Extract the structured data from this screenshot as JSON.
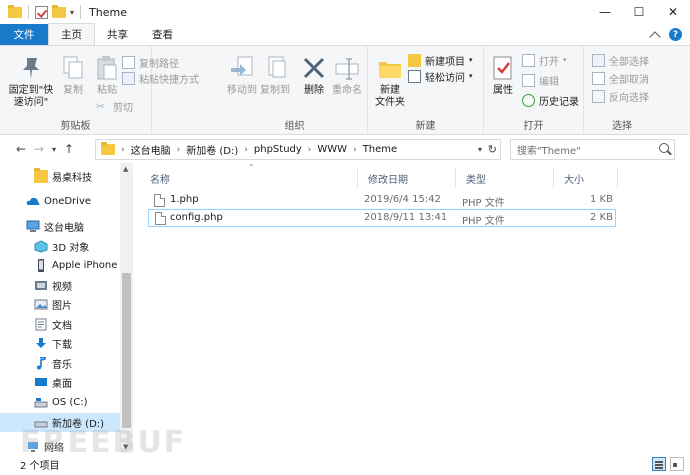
{
  "window": {
    "title": "Theme",
    "controls": {
      "minimize": "—",
      "maximize": "☐",
      "close": "✕"
    }
  },
  "tabs": [
    {
      "label": "文件"
    },
    {
      "label": "主页"
    },
    {
      "label": "共享"
    },
    {
      "label": "查看"
    }
  ],
  "ribbon": {
    "clipboard": {
      "label": "剪贴板",
      "pin": "固定到\"快\n速访问\"",
      "copy": "复制",
      "paste": "粘贴",
      "copy_path": "复制路径",
      "paste_shortcut": "粘贴快捷方式",
      "cut": "剪切"
    },
    "organize": {
      "label": "组织",
      "move_to": "移动到",
      "copy_to": "复制到",
      "delete": "删除",
      "rename": "重命名"
    },
    "new": {
      "label": "新建",
      "new_folder": "新建\n文件夹",
      "new_item": "新建项目",
      "easy_access": "轻松访问"
    },
    "open": {
      "label": "打开",
      "properties": "属性",
      "open": "打开",
      "edit": "编辑",
      "history": "历史记录"
    },
    "select": {
      "label": "选择",
      "select_all": "全部选择",
      "select_none": "全部取消",
      "invert": "反向选择"
    }
  },
  "address": {
    "crumbs": [
      "这台电脑",
      "新加卷 (D:)",
      "phpStudy",
      "WWW",
      "Theme"
    ],
    "search_placeholder": "搜索\"Theme\""
  },
  "nav": {
    "items": [
      {
        "label": "易桌科技"
      },
      {
        "label": "OneDrive"
      },
      {
        "label": "这台电脑"
      },
      {
        "label": "3D 对象"
      },
      {
        "label": "Apple iPhone"
      },
      {
        "label": "视频"
      },
      {
        "label": "图片"
      },
      {
        "label": "文档"
      },
      {
        "label": "下载"
      },
      {
        "label": "音乐"
      },
      {
        "label": "桌面"
      },
      {
        "label": "OS (C:)"
      },
      {
        "label": "新加卷 (D:)"
      },
      {
        "label": "网络"
      }
    ]
  },
  "filelist": {
    "columns": {
      "name": "名称",
      "date": "修改日期",
      "type": "类型",
      "size": "大小"
    },
    "rows": [
      {
        "name": "1.php",
        "date": "2019/6/4 15:42",
        "type": "PHP 文件",
        "size": "1 KB"
      },
      {
        "name": "config.php",
        "date": "2018/9/11 13:41",
        "type": "PHP 文件",
        "size": "2 KB"
      }
    ]
  },
  "status": {
    "count": "2 个项目"
  },
  "watermark": "FREEBUF"
}
